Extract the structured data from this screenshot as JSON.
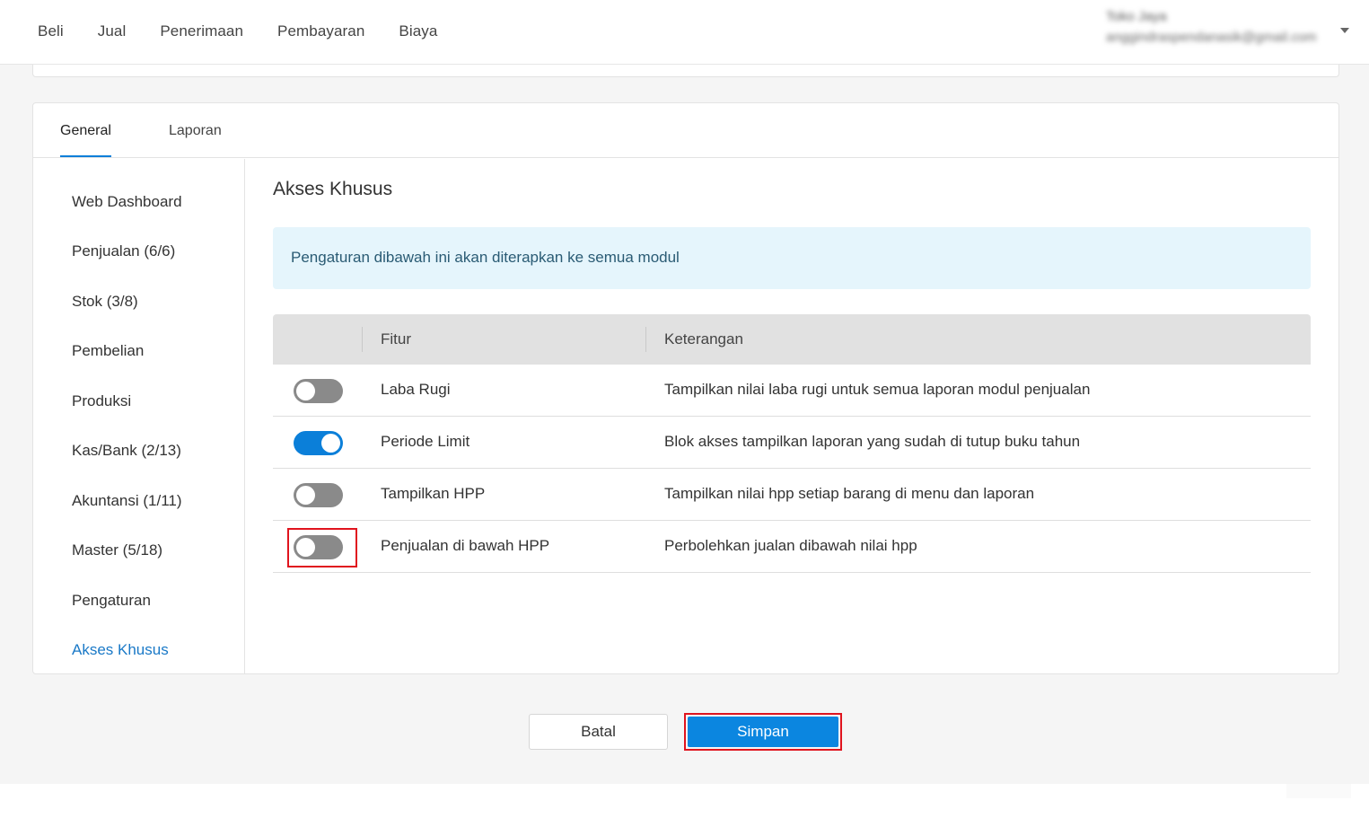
{
  "topnav": {
    "items": [
      "Beli",
      "Jual",
      "Penerimaan",
      "Pembayaran",
      "Biaya"
    ]
  },
  "user": {
    "name": "Toko Jaya",
    "email": "anggindraspendanasik@gmail.com"
  },
  "tabs": {
    "general": "General",
    "laporan": "Laporan"
  },
  "sidebar": {
    "items": [
      "Web Dashboard",
      "Penjualan (6/6)",
      "Stok (3/8)",
      "Pembelian",
      "Produksi",
      "Kas/Bank (2/13)",
      "Akuntansi (1/11)",
      "Master (5/18)",
      "Pengaturan",
      "Akses Khusus"
    ],
    "active_index": 9
  },
  "main": {
    "title": "Akses Khusus",
    "info": "Pengaturan dibawah ini akan diterapkan ke semua modul",
    "table": {
      "headers": {
        "fitur": "Fitur",
        "keterangan": "Keterangan"
      },
      "rows": [
        {
          "fitur": "Laba Rugi",
          "keterangan": "Tampilkan nilai laba rugi untuk semua laporan modul penjualan",
          "enabled": false
        },
        {
          "fitur": "Periode Limit",
          "keterangan": "Blok akses tampilkan laporan yang sudah di tutup buku tahun",
          "enabled": true
        },
        {
          "fitur": "Tampilkan HPP",
          "keterangan": "Tampilkan nilai hpp setiap barang di menu dan laporan",
          "enabled": false
        },
        {
          "fitur": "Penjualan di bawah HPP",
          "keterangan": "Perbolehkan jualan dibawah nilai hpp",
          "enabled": false
        }
      ]
    }
  },
  "actions": {
    "cancel": "Batal",
    "save": "Simpan"
  },
  "colors": {
    "accent": "#0b7fd9",
    "highlight": "#e0141e",
    "info_bg": "#e5f5fc"
  }
}
